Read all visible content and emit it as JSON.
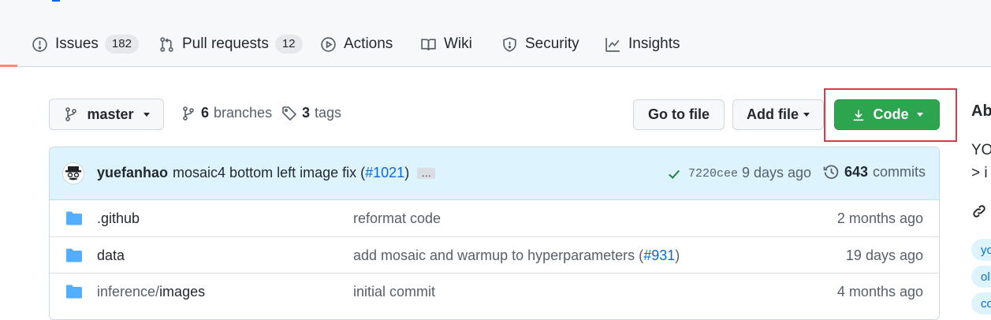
{
  "nav": {
    "tabs": [
      {
        "label": "Issues",
        "count": "182",
        "icon": "issue-opened-icon"
      },
      {
        "label": "Pull requests",
        "count": "12",
        "icon": "git-pull-request-icon"
      },
      {
        "label": "Actions",
        "icon": "play-icon"
      },
      {
        "label": "Wiki",
        "icon": "book-icon"
      },
      {
        "label": "Security",
        "icon": "shield-icon"
      },
      {
        "label": "Insights",
        "icon": "graph-icon"
      }
    ]
  },
  "toolbar": {
    "branch": "master",
    "branches_count": "6",
    "branches_label": "branches",
    "tags_count": "3",
    "tags_label": "tags",
    "go_to_file": "Go to file",
    "add_file": "Add file",
    "code": "Code"
  },
  "commit": {
    "author": "yuefanhao",
    "message_prefix": "mosaic4 bottom left image fix (",
    "pr": "#1021",
    "message_suffix": ")",
    "ellipsis": "…",
    "sha": "7220cee",
    "time": "9 days ago",
    "commits_count": "643",
    "commits_label": "commits"
  },
  "files": [
    {
      "name": ".github",
      "message": "reformat code",
      "time": "2 months ago"
    },
    {
      "name": "data",
      "message_prefix": "add mosaic and warmup to hyperparameters (",
      "message_link": "#931",
      "message_suffix": ")",
      "time": "19 days ago"
    },
    {
      "name_prefix": "inference/",
      "name_suffix": "images",
      "message": "initial commit",
      "time": "4 months ago"
    }
  ],
  "about": {
    "title": "Ab",
    "text_line1": "YO",
    "text_line2": "> i",
    "topics": [
      "yo",
      "ol",
      "co"
    ]
  },
  "colors": {
    "code_button": "#2da44e",
    "link": "#0969da",
    "highlight_box": "#d73a49"
  }
}
